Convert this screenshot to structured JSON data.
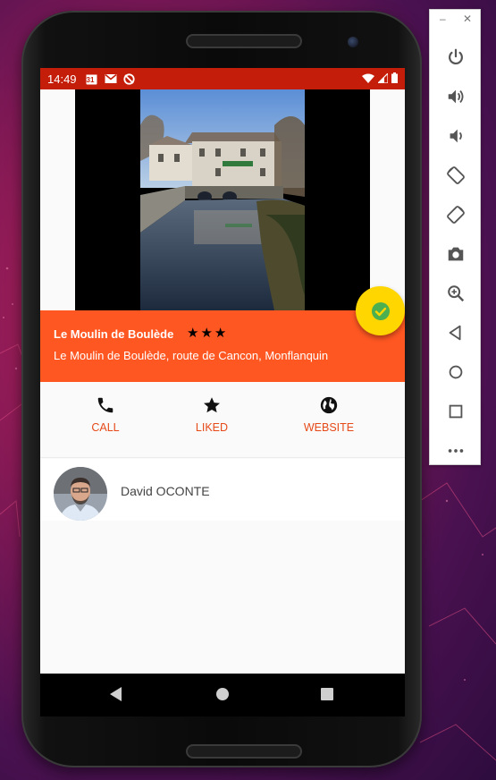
{
  "status_bar": {
    "time": "14:49",
    "icons": [
      "calendar-icon",
      "gmail-icon",
      "sync-disabled-icon",
      "wifi-icon",
      "signal-icon",
      "battery-icon"
    ],
    "calendar_day": "31",
    "background_color": "#c41e0a"
  },
  "place": {
    "name": "Le Moulin de Boulède",
    "rating_stars": "★★★",
    "address": "Le Moulin de Boulède, route de Cancon, Monflanquin",
    "band_color": "#ff5722"
  },
  "fab": {
    "icon": "check-circle-icon",
    "color": "#ffd600"
  },
  "actions": [
    {
      "label": "CALL",
      "icon": "phone-icon"
    },
    {
      "label": "LIKED",
      "icon": "star-icon"
    },
    {
      "label": "WEBSITE",
      "icon": "globe-icon"
    }
  ],
  "contact": {
    "name": "David OCONTE"
  },
  "nav": {
    "buttons": [
      "back-icon",
      "home-icon",
      "recents-icon"
    ]
  },
  "emulator_toolbar": {
    "window_controls": [
      "minimize-icon",
      "close-icon"
    ],
    "buttons": [
      "power-icon",
      "volume-up-icon",
      "volume-down-icon",
      "rotate-left-icon",
      "rotate-right-icon",
      "camera-icon",
      "zoom-icon",
      "back-icon",
      "home-icon",
      "overview-icon",
      "more-icon"
    ]
  }
}
